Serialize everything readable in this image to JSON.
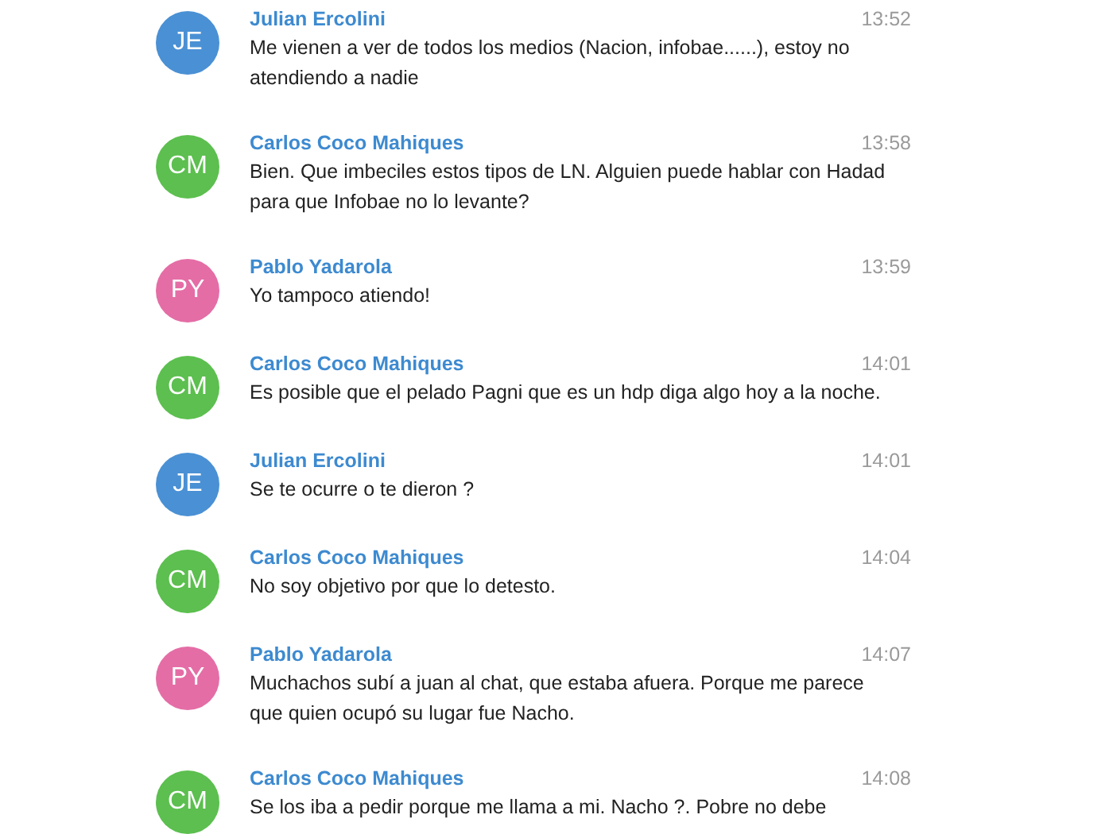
{
  "messages": [
    {
      "initials": "JE",
      "color": "#4a90d4",
      "author": "Julian Ercolini",
      "time": "13:52",
      "text": "Me vienen a ver de todos los medios (Nacion, infobae......), estoy no\natendiendo a nadie"
    },
    {
      "initials": "CM",
      "color": "#5cbf4f",
      "author": "Carlos Coco Mahiques",
      "time": "13:58",
      "text": "Bien. Que imbeciles estos tipos de LN. Alguien puede hablar con Hadad\npara que Infobae no lo levante?"
    },
    {
      "initials": "PY",
      "color": "#e46da6",
      "author": "Pablo Yadarola",
      "time": "13:59",
      "text": "Yo tampoco atiendo!"
    },
    {
      "initials": "CM",
      "color": "#5cbf4f",
      "author": "Carlos Coco Mahiques",
      "time": "14:01",
      "text": "Es posible que el pelado Pagni que es un hdp diga algo hoy a la noche."
    },
    {
      "initials": "JE",
      "color": "#4a90d4",
      "author": "Julian Ercolini",
      "time": "14:01",
      "text": "Se te ocurre o te dieron ?"
    },
    {
      "initials": "CM",
      "color": "#5cbf4f",
      "author": "Carlos Coco Mahiques",
      "time": "14:04",
      "text": "No soy objetivo por que lo detesto."
    },
    {
      "initials": "PY",
      "color": "#e46da6",
      "author": "Pablo Yadarola",
      "time": "14:07",
      "text": "Muchachos subí a juan al chat, que estaba afuera. Porque me parece\nque quien ocupó su lugar fue Nacho."
    },
    {
      "initials": "CM",
      "color": "#5cbf4f",
      "author": "Carlos Coco Mahiques",
      "time": "14:08",
      "text": "Se los iba a pedir porque me llama a mi. Nacho ?. Pobre no debe"
    }
  ]
}
